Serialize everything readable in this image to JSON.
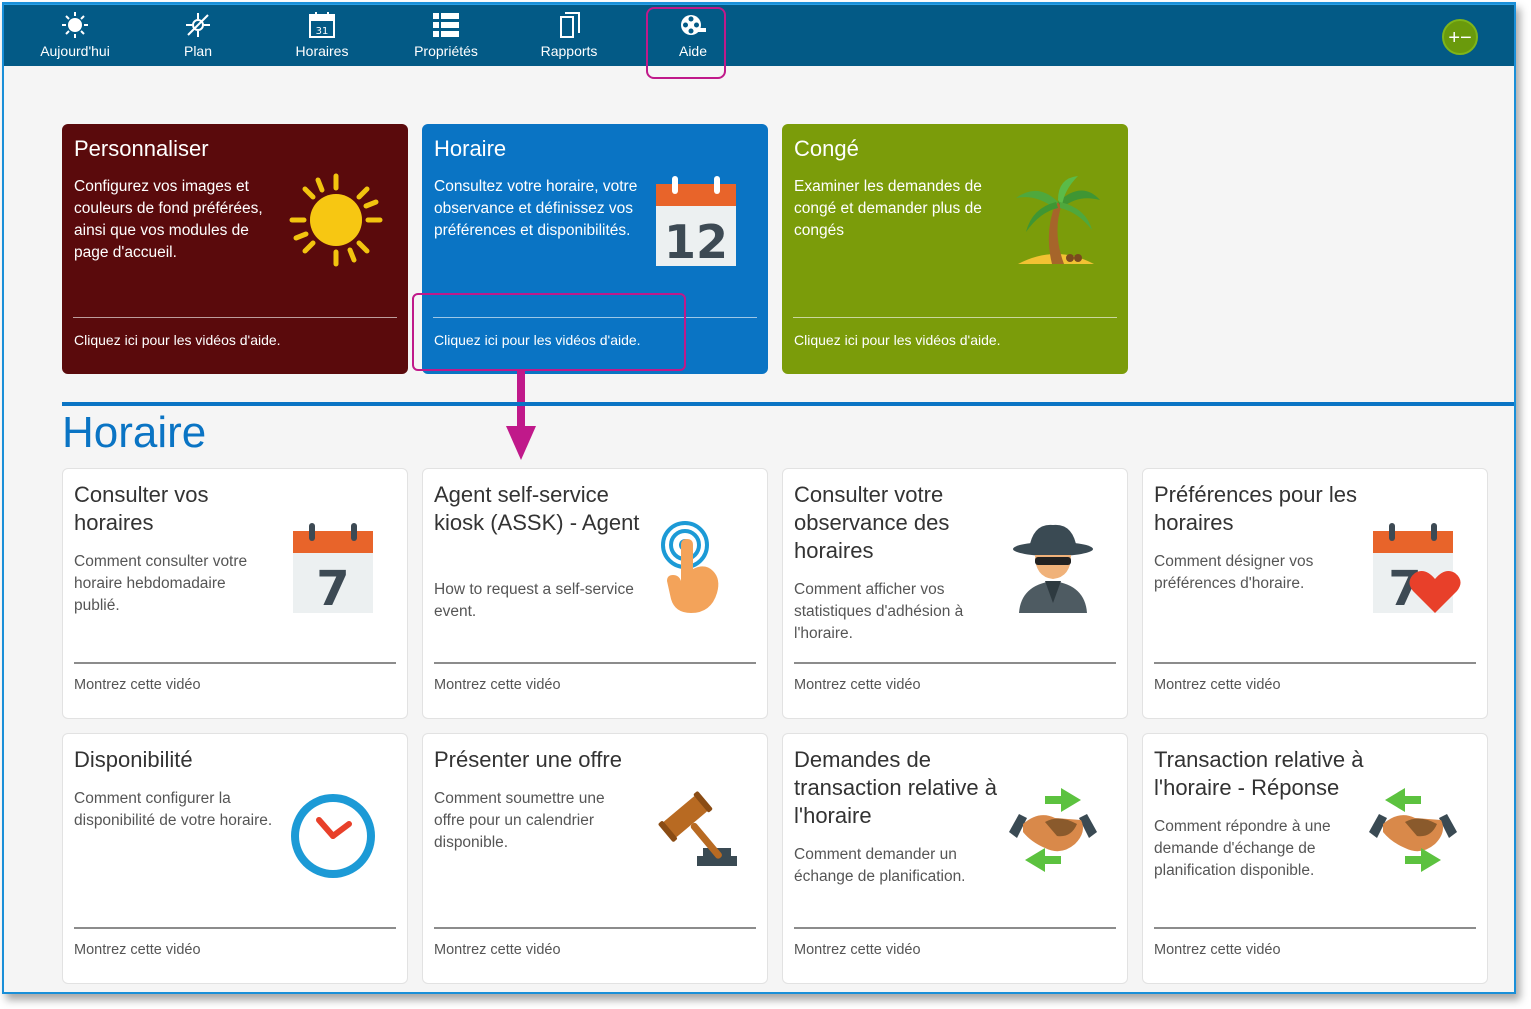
{
  "nav": {
    "items": [
      {
        "label": "Aujourd'hui",
        "icon": "sun-icon"
      },
      {
        "label": "Plan",
        "icon": "compass-icon"
      },
      {
        "label": "Horaires",
        "icon": "calendar-icon"
      },
      {
        "label": "Propriétés",
        "icon": "list-icon"
      },
      {
        "label": "Rapports",
        "icon": "document-icon"
      },
      {
        "label": "Aide",
        "icon": "film-reel-icon"
      }
    ],
    "active": "Aide",
    "profile_symbol": "+−"
  },
  "hero": [
    {
      "title": "Personnaliser",
      "description": "Configurez vos images et couleurs de fond préférées, ainsi que vos modules de page d'accueil.",
      "link": "Cliquez ici pour les vidéos d'aide.",
      "color": "#5a0a0c",
      "icon": "sun-icon"
    },
    {
      "title": "Horaire",
      "description": "Consultez votre horaire, votre observance et définissez vos préférences et disponibilités.",
      "link": "Cliquez ici pour les vidéos d'aide.",
      "color": "#0a74c4",
      "icon": "calendar-12-icon",
      "day": "12"
    },
    {
      "title": "Congé",
      "description": "Examiner les demandes de congé et demander plus de congés",
      "link": "Cliquez ici pour les vidéos d'aide.",
      "color": "#7b9c0a",
      "icon": "palm-tree-icon"
    }
  ],
  "section": {
    "title": "Horaire",
    "cards": [
      {
        "title": "Consulter vos horaires",
        "description": "Comment consulter votre horaire hebdomadaire publié.",
        "link": "Montrez cette vidéo",
        "icon": "calendar-7-icon",
        "day": "7"
      },
      {
        "title": "Agent self-service kiosk (ASSK) - Agent",
        "description": "How to request a self-service event.",
        "link": "Montrez cette vidéo",
        "icon": "touch-hand-icon"
      },
      {
        "title": "Consulter votre observance des horaires",
        "description": "Comment afficher vos statistiques d'adhésion à l'horaire.",
        "link": "Montrez cette vidéo",
        "icon": "spy-icon"
      },
      {
        "title": "Préférences pour les horaires",
        "description": "Comment désigner vos préférences d'horaire.",
        "link": "Montrez cette vidéo",
        "icon": "calendar-heart-icon",
        "day": "7"
      },
      {
        "title": "Disponibilité",
        "description": "Comment configurer la disponibilité de votre horaire.",
        "link": "Montrez cette vidéo",
        "icon": "clock-icon"
      },
      {
        "title": "Présenter une offre",
        "description": "Comment soumettre une offre pour un calendrier disponible.",
        "link": "Montrez cette vidéo",
        "icon": "gavel-icon"
      },
      {
        "title": "Demandes de transaction relative à l'horaire",
        "description": "Comment demander un échange de planification.",
        "link": "Montrez cette vidéo",
        "icon": "handshake-arrows-icon"
      },
      {
        "title": "Transaction relative à l'horaire - Réponse",
        "description": "Comment répondre à une demande d'échange de planification disponible.",
        "link": "Montrez cette vidéo",
        "icon": "handshake-arrows-icon"
      }
    ]
  }
}
